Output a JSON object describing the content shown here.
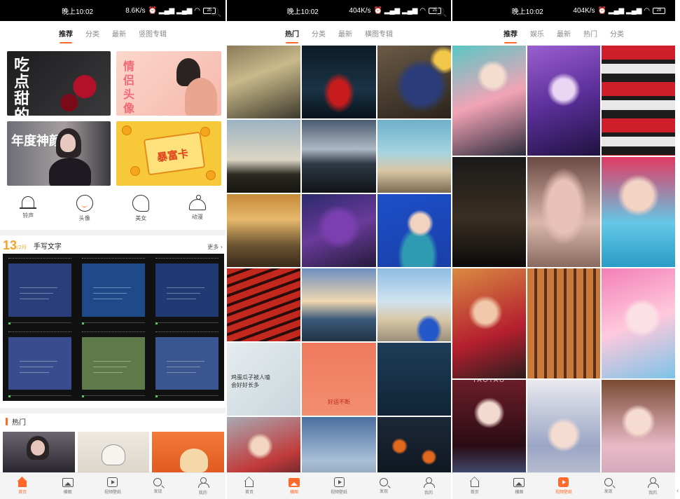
{
  "screens": [
    {
      "status": {
        "time": "晚上10:02",
        "speed": "8.6K/s",
        "signal": "⏰ ᯤ ᯤ",
        "battery": "28"
      },
      "tabs": [
        {
          "label": "推荐",
          "active": true
        },
        {
          "label": "分类"
        },
        {
          "label": "最新"
        },
        {
          "label": "竖图专辑"
        }
      ],
      "banners": [
        {
          "text": "吃点甜的",
          "theme": "dessert"
        },
        {
          "text": "情侣头像",
          "theme": "couple"
        },
        {
          "text": "年度神颜",
          "theme": "portrait"
        },
        {
          "text": "暴富卡",
          "theme": "lucky-card"
        }
      ],
      "categories": [
        {
          "label": "铃声",
          "icon": "bell-icon"
        },
        {
          "label": "头像",
          "icon": "smile-icon"
        },
        {
          "label": "美女",
          "icon": "head-icon"
        },
        {
          "label": "动漫",
          "icon": "helmet-icon"
        }
      ],
      "daily": {
        "day": "13",
        "month": "/2月",
        "title": "手写文字",
        "more": "更多 ›"
      },
      "handwriting_colors": [
        "#2a3e7c",
        "#1f4a8a",
        "#223a73",
        "#394c8e",
        "#5f7a4a",
        "#3b5590"
      ],
      "hot": {
        "title": "热门"
      }
    },
    {
      "status": {
        "time": "晚上10:02",
        "speed": "404K/s",
        "battery": "28"
      },
      "tabs": [
        {
          "label": "热门",
          "active": true
        },
        {
          "label": "分类"
        },
        {
          "label": "最新"
        },
        {
          "label": "横图专辑"
        }
      ],
      "tiles": [
        {
          "name": "woman-in-room",
          "bg": "linear-gradient(160deg,#8a7a5a,#c9b98a 40%,#3d3a2c)"
        },
        {
          "name": "sports-car",
          "bg": "radial-gradient(ellipse at 50% 65%,#c81c1c 0 18%,transparent 30%),linear-gradient(180deg,#0d1b26,#1a3346 60%,#07121a)"
        },
        {
          "name": "blueberries",
          "bg": "radial-gradient(circle at 60% 55%,#2a3d7a 0 30%,transparent 45%),radial-gradient(circle at 90% 20%,#f2c84b 0 10%,transparent 16%),linear-gradient(160deg,#6b5a45,#2b241c)"
        },
        {
          "name": "mountain-mist",
          "bg": "linear-gradient(180deg,#9cb2c2,#dcd6c4 55%,#2c2a22 75%,#15140f)"
        },
        {
          "name": "dark-coast",
          "bg": "linear-gradient(180deg,#4a5b70,#aeb9c6 40%,#2f3a45 60%,#111418)"
        },
        {
          "name": "beach-girl",
          "bg": "linear-gradient(180deg,#6fb0c9,#a4d4e0 45%,#d9c7a3 70%,#7a6a52)"
        },
        {
          "name": "train-window",
          "bg": "linear-gradient(180deg,#c68a3a,#e7b86c 35%,#6c5432 70%,#3a2a1a)"
        },
        {
          "name": "purple-dessert",
          "bg": "radial-gradient(circle at 50% 45%,#7b3fb0 0 26%,transparent 40%),linear-gradient(160deg,#2b2a6b,#6a3a9a 50%,#241b3a)"
        },
        {
          "name": "cheongsam-girl",
          "bg": "radial-gradient(circle at 58% 40%,#f1d3c0 0 15%,transparent 22%),radial-gradient(ellipse at 55% 85%,#2f9bb2 0 26%,transparent 35%),linear-gradient(160deg,#1d4fc9,#1a3fa8)"
        },
        {
          "name": "red-pagoda",
          "bg": "repeating-linear-gradient(160deg,#c3281e 0 9px,#2a0c0a 9px 13px),linear-gradient(180deg,#5aa6e0,#2e6fb8)"
        },
        {
          "name": "city-sunset",
          "bg": "linear-gradient(180deg,#6d8fc2,#f0d7b0 45%,#3a5a7a 70%,#223344)"
        },
        {
          "name": "street-car",
          "bg": "radial-gradient(ellipse at 70% 85%,#2457c7 0 12%,transparent 18%),linear-gradient(180deg,#8fbde2,#cfe3f0 45%,#d8c8a8 70%,#9a8f7a)"
        },
        {
          "name": "handwriting-note",
          "bg": "linear-gradient(135deg,#e6ecef,#c9d6dc)"
        },
        {
          "name": "lucky-cartoon",
          "bg": "linear-gradient(180deg,#f07a5e,#f38e70)"
        },
        {
          "name": "dark-teal",
          "bg": "linear-gradient(180deg,#1e3d57,#0f2436)"
        },
        {
          "name": "anime-girl-red",
          "bg": "radial-gradient(circle at 45% 40%,#f3d6c2 0 14%,transparent 22%),linear-gradient(160deg,#a9a9b3,#c13a3a 60%,#3a1e2a)"
        },
        {
          "name": "power-lines",
          "bg": "linear-gradient(180deg,#4b6fa0,#a9c0d8 60%,#7d8a99)"
        },
        {
          "name": "lanterns",
          "bg": "radial-gradient(circle at 30% 40%,#e0681e 0 8%,transparent 12%),radial-gradient(circle at 70% 55%,#e0681e 0 8%,transparent 12%),linear-gradient(180deg,#1c2838,#0c121a)"
        }
      ],
      "captions": {
        "handwriting": "鸡蛋瓜子被人嗑\n会好好长多",
        "lucky": "好运不断"
      }
    },
    {
      "status": {
        "time": "晚上10:02",
        "speed": "404K/s",
        "battery": "28"
      },
      "tabs": [
        {
          "label": "推荐",
          "active": true
        },
        {
          "label": "娱乐"
        },
        {
          "label": "最新"
        },
        {
          "label": "热门"
        },
        {
          "label": "分类"
        }
      ],
      "tiles": [
        {
          "name": "miku-anime",
          "bg": "radial-gradient(circle at 55% 28%,#f4dccf 0 12%,transparent 18%),linear-gradient(160deg,#59c7c5,#f2a3b6 50%,#2b2b3a)"
        },
        {
          "name": "purple-anime",
          "bg": "radial-gradient(circle at 50% 40%,#e9d6f5 0 14%,transparent 22%),linear-gradient(160deg,#9b5fd0,#5b2f9a 50%,#1f1240)"
        },
        {
          "name": "red-motorbike",
          "bg": "repeating-linear-gradient(180deg,#cf1f2a 0 20px,#1c1c1c 20px 26px,#e8e8e8 26px 40px,#1c1c1c 40px 52px)"
        },
        {
          "name": "dark-window",
          "bg": "linear-gradient(180deg,#1a1a1a,#3a2e22 55%,#0b0b0b)"
        },
        {
          "name": "face-closeup",
          "bg": "radial-gradient(ellipse at 50% 45%,#e8c2b6 0 30%,transparent 45%),linear-gradient(180deg,#6b4a44,#d9b7ab 60%,#8a6a60)"
        },
        {
          "name": "boy-portrait",
          "bg": "radial-gradient(circle at 50% 35%,#f3d4c4 0 18%,transparent 26%),linear-gradient(180deg,#e13a62,#64c8e6 60%,#2a9cc6)"
        },
        {
          "name": "rabbit-girl",
          "bg": "radial-gradient(circle at 45% 40%,#f0c7a8 0 14%,transparent 22%),linear-gradient(160deg,#d98a42,#b51f2f 60%,#2a1d1d)"
        },
        {
          "name": "shadow-stripes",
          "bg": "repeating-linear-gradient(90deg,#c97a3a 0 10px,#5a2e18 10px 14px)"
        },
        {
          "name": "pink-anime",
          "bg": "radial-gradient(circle at 55% 45%,#fbe1e6 0 18%,transparent 26%),linear-gradient(160deg,#f37fb6,#ffc9dc 50%,#7cc3e8)"
        },
        {
          "name": "cosplay-girl",
          "bg": "radial-gradient(circle at 50% 30%,#f2dad0 0 12%,transparent 18%),linear-gradient(180deg,#6b1d2a,#2a0c14 60%,#4d6ea3)"
        },
        {
          "name": "fur-hood-girl",
          "bg": "radial-gradient(circle at 50% 50%,#f5dcd2 0 18%,transparent 26%),linear-gradient(180deg,#e9e9ee,#9ba6c6 60%,#c8c8d4)"
        },
        {
          "name": "hanfu-girl",
          "bg": "radial-gradient(circle at 50% 38%,#f6dcd0 0 15%,transparent 22%),linear-gradient(180deg,#7a4a33,#e9b9c7 60%,#c6a1b3)"
        }
      ],
      "watermark": "YAOYAO"
    }
  ],
  "bottom_nav": {
    "screen1": [
      {
        "label": "首页",
        "icon": "home-icon",
        "active": true
      },
      {
        "label": "横图",
        "icon": "picture-icon"
      },
      {
        "label": "视频壁纸",
        "icon": "play-icon"
      },
      {
        "label": "发现",
        "icon": "search-icon"
      },
      {
        "label": "我的",
        "icon": "user-icon"
      }
    ],
    "screen2": [
      {
        "label": "首页",
        "icon": "home-icon"
      },
      {
        "label": "横图",
        "icon": "picture-icon",
        "active": true
      },
      {
        "label": "视频壁纸",
        "icon": "play-icon"
      },
      {
        "label": "发现",
        "icon": "search-icon"
      },
      {
        "label": "我的",
        "icon": "user-icon"
      }
    ],
    "screen3": [
      {
        "label": "首页",
        "icon": "home-icon"
      },
      {
        "label": "横图",
        "icon": "picture-icon"
      },
      {
        "label": "视频壁纸",
        "icon": "play-icon",
        "active": true
      },
      {
        "label": "发现",
        "icon": "search-icon"
      },
      {
        "label": "我的",
        "icon": "user-icon"
      }
    ]
  },
  "accent_color": "#ff6a2a",
  "edge_glyph": "‹"
}
